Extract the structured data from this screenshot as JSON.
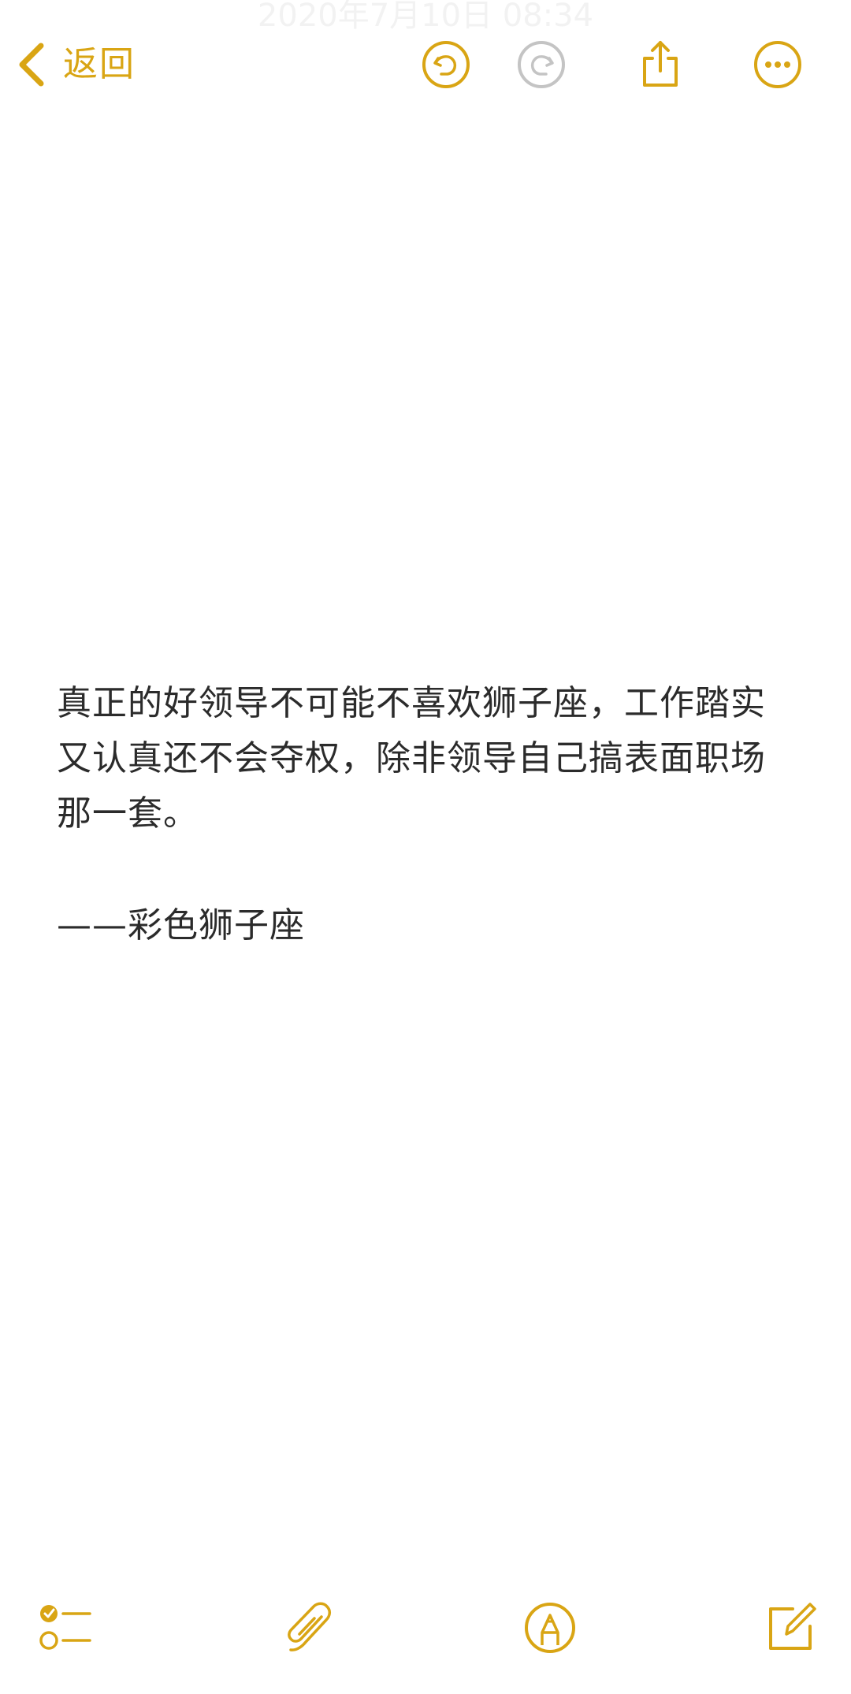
{
  "app": {
    "accent_color": "#d9a514",
    "inactive_color": "#c4c4c4",
    "text_color": "#2b2b2b",
    "background_color": "#ffffff"
  },
  "top_bar": {
    "header_date": "2020年7月10日 08:34",
    "back_label": "返回",
    "icons": [
      {
        "name": "undo-icon",
        "state": "enabled"
      },
      {
        "name": "redo-icon",
        "state": "disabled"
      },
      {
        "name": "share-icon",
        "state": "enabled"
      },
      {
        "name": "more-icon",
        "state": "enabled"
      }
    ]
  },
  "note": {
    "paragraph_1": "真正的好领导不可能不喜欢狮子座，工作踏实又认真还不会夺权，除非领导自己搞表面职场那一套。",
    "paragraph_2": "——彩色狮子座"
  },
  "bottom_bar": {
    "icons": [
      {
        "name": "checklist-icon"
      },
      {
        "name": "attachment-icon"
      },
      {
        "name": "markup-icon"
      },
      {
        "name": "compose-icon"
      }
    ]
  }
}
